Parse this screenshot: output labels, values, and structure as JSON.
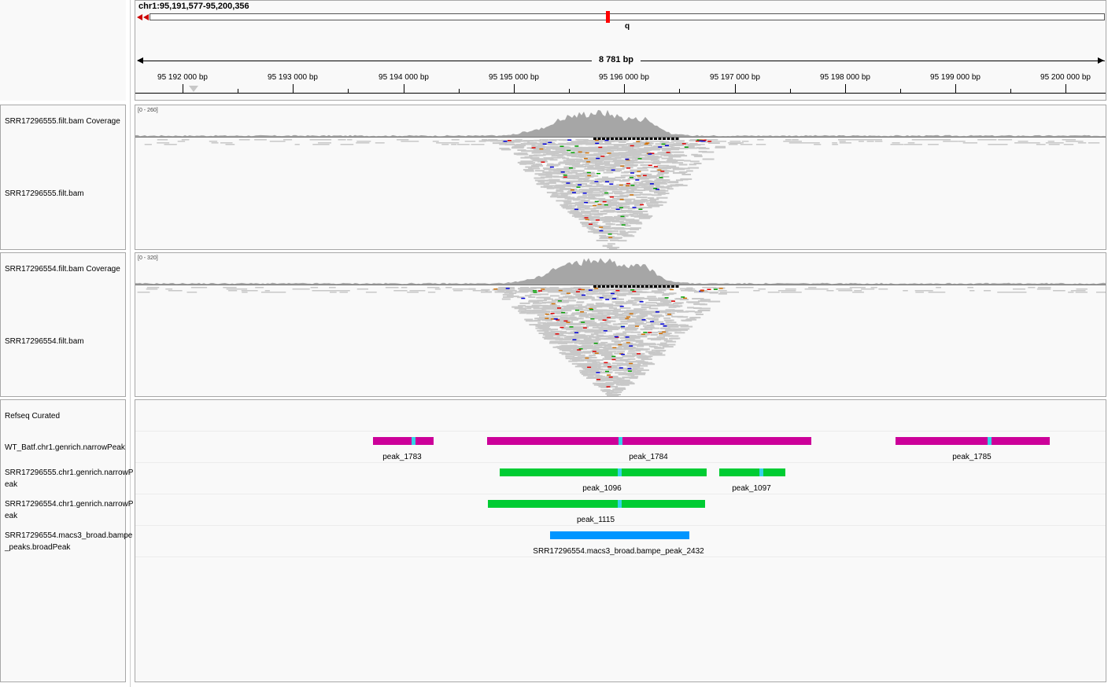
{
  "locus": "chr1:95,191,577-95,200,356",
  "cytoband": "q",
  "span": "8 781 bp",
  "ruler": {
    "ticks": [
      "95 192 000 bp",
      "95 193 000 bp",
      "95 194 000 bp",
      "95 195 000 bp",
      "95 196 000 bp",
      "95 197 000 bp",
      "95 198 000 bp",
      "95 199 000 bp",
      "95 200 000 bp"
    ]
  },
  "tracks": {
    "bam1": {
      "coverage_label": "SRR17296555.filt.bam Coverage",
      "alignment_label": "SRR17296555.filt.bam",
      "range": "[0 - 260]"
    },
    "bam2": {
      "coverage_label": "SRR17296554.filt.bam Coverage",
      "alignment_label": "SRR17296554.filt.bam",
      "range": "[0 - 320]"
    },
    "refseq": {
      "label": "Refseq Curated"
    },
    "peaks1": {
      "label": "WT_Batf.chr1.genrich.narrowPeak",
      "features": [
        "peak_1783",
        "peak_1784",
        "peak_1785"
      ]
    },
    "peaks2": {
      "label": "SRR17296555.chr1.genrich.narrowPeak",
      "features": [
        "peak_1096",
        "peak_1097"
      ]
    },
    "peaks3": {
      "label": "SRR17296554.chr1.genrich.narrowPeak",
      "features": [
        "peak_1115"
      ]
    },
    "peaks4": {
      "label": "SRR17296554.macs3_broad.bampe_peaks.broadPeak",
      "features": [
        "SRR17296554.macs3_broad.bampe_peak_2432"
      ]
    }
  },
  "colors": {
    "narrowpeak": "#cc0099",
    "genrich": "#00cc33",
    "broadpeak": "#0096ff",
    "summit": "#35d2e6",
    "reads": "#c8c8c8",
    "coverage": "#a6a6a6"
  }
}
